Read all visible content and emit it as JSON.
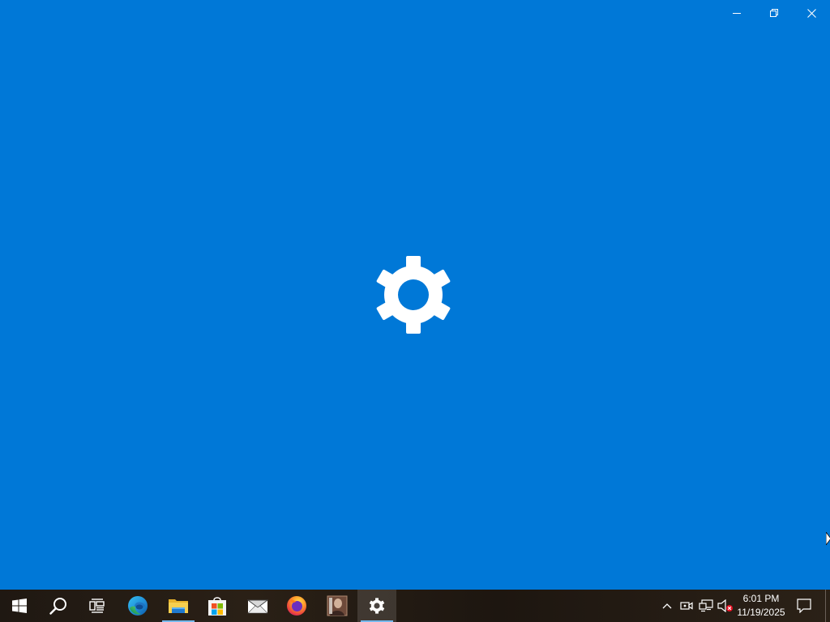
{
  "window": {
    "title_buttons": {
      "minimize_icon": "minimize-icon",
      "restore_icon": "restore-icon",
      "close_icon": "close-icon"
    },
    "splash_icon": "settings-gear-icon",
    "background_color": "#0078d7"
  },
  "taskbar": {
    "items": [
      {
        "name": "start-button",
        "icon": "windows-logo-icon"
      },
      {
        "name": "search-button",
        "icon": "search-icon"
      },
      {
        "name": "task-view-button",
        "icon": "task-view-icon"
      },
      {
        "name": "edge-button",
        "icon": "edge-icon"
      },
      {
        "name": "file-explorer-button",
        "icon": "folder-icon"
      },
      {
        "name": "store-button",
        "icon": "store-icon"
      },
      {
        "name": "mail-button",
        "icon": "mail-icon"
      },
      {
        "name": "firefox-button",
        "icon": "firefox-icon"
      },
      {
        "name": "photo-app-button",
        "icon": "photo-thumbnail-icon"
      },
      {
        "name": "settings-button",
        "icon": "gear-icon"
      }
    ],
    "tray": {
      "icons": [
        "chevron-up-icon",
        "meet-now-icon",
        "network-icon",
        "volume-muted-icon"
      ],
      "time": "6:01 PM",
      "date": "11/19/2025",
      "notification_icon": "notification-icon"
    },
    "running_indicator_color": "#76b9ed"
  }
}
